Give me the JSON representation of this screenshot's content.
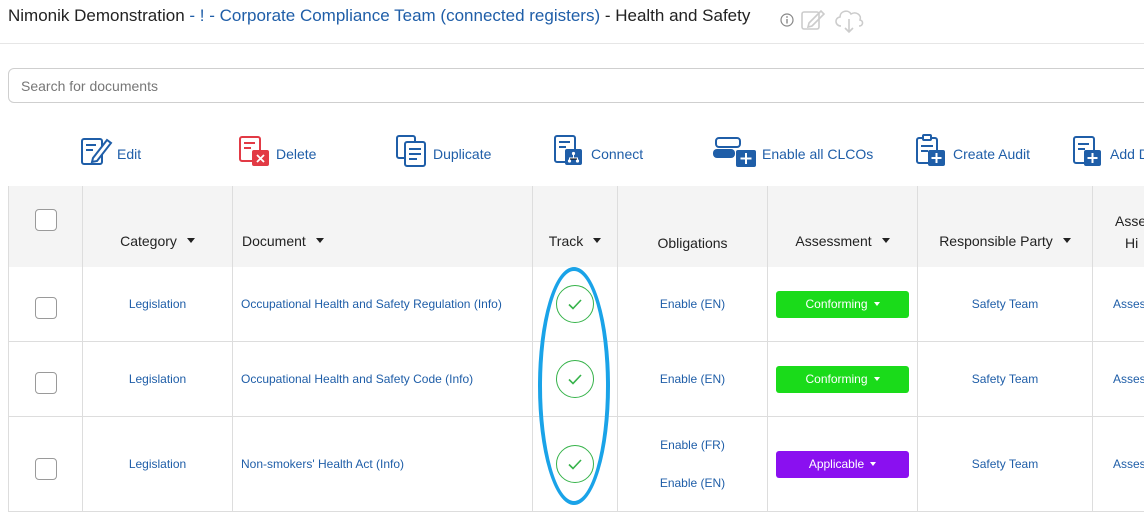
{
  "header": {
    "prefix": "Nimonik Demonstration",
    "link": " - ! - Corporate Compliance Team (connected registers)",
    "suffix": " - Health and Safety",
    "icons": [
      "info-icon",
      "edit-icon",
      "cloud-download-icon"
    ]
  },
  "search": {
    "placeholder": "Search for documents"
  },
  "toolbar": {
    "edit": "Edit",
    "delete": "Delete",
    "duplicate": "Duplicate",
    "connect": "Connect",
    "enable_clcos": "Enable all CLCOs",
    "create_audit": "Create Audit",
    "add": "Add D"
  },
  "columns": {
    "category": "Category",
    "document": "Document",
    "track": "Track",
    "obligations": "Obligations",
    "assessment": "Assessment",
    "responsible": "Responsible Party",
    "assess_history_1": "Asse",
    "assess_history_2": "Hi"
  },
  "rows": [
    {
      "category": "Legislation",
      "document": "Occupational Health and Safety Regulation (Info)",
      "obligations": [
        "Enable (EN)"
      ],
      "assessment": "Conforming",
      "assessment_color": "#1adb1a",
      "responsible": "Safety Team",
      "history": "Asses"
    },
    {
      "category": "Legislation",
      "document": "Occupational Health and Safety Code (Info)",
      "obligations": [
        "Enable (EN)"
      ],
      "assessment": "Conforming",
      "assessment_color": "#1adb1a",
      "responsible": "Safety Team",
      "history": "Asses"
    },
    {
      "category": "Legislation",
      "document": "Non-smokers' Health Act (Info)",
      "obligations": [
        "Enable (FR)",
        "Enable (EN)"
      ],
      "assessment": "Applicable",
      "assessment_color": "#8a10f0",
      "responsible": "Safety Team",
      "history": "Asses"
    }
  ],
  "colors": {
    "link": "#1f5ea8",
    "conforming": "#1adb1a",
    "applicable": "#8a10f0",
    "track_check": "#36b34a",
    "highlight": "#1aa3e8"
  }
}
